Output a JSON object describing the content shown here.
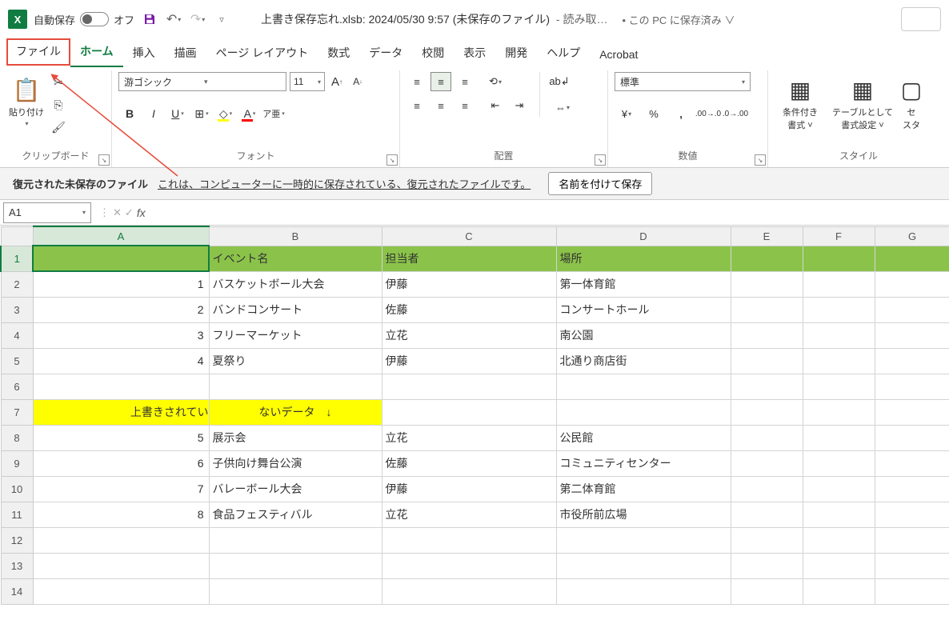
{
  "title": {
    "autosave_label": "自動保存",
    "autosave_state": "オフ",
    "filename": "上書き保存忘れ.xlsb: 2024/05/30 9:57 (未保存のファイル)",
    "readonly": " - 読み取…",
    "saved_location": "• この PC に保存済み ∨"
  },
  "menu": {
    "file": "ファイル",
    "home": "ホーム",
    "insert": "挿入",
    "draw": "描画",
    "layout": "ページ レイアウト",
    "formulas": "数式",
    "data": "データ",
    "review": "校閲",
    "view": "表示",
    "developer": "開発",
    "help": "ヘルプ",
    "acrobat": "Acrobat"
  },
  "ribbon": {
    "clipboard": {
      "paste": "貼り付け",
      "label": "クリップボード"
    },
    "font": {
      "name": "游ゴシック",
      "size": "11",
      "label": "フォント"
    },
    "align": {
      "label": "配置"
    },
    "number": {
      "format": "標準",
      "label": "数値"
    },
    "styles": {
      "cond": "条件付き\n書式 ˅",
      "table": "テーブルとして\n書式設定 ˅",
      "cell": "セ\nスタ",
      "label": "スタイル"
    }
  },
  "recovery": {
    "title": "復元された未保存のファイル",
    "msg": "これは、コンピューターに一時的に保存されている、復元されたファイルです。",
    "btn": "名前を付けて保存"
  },
  "namebox": "A1",
  "cols": [
    "A",
    "B",
    "C",
    "D",
    "E",
    "F",
    "G"
  ],
  "rows": [
    {
      "n": "1",
      "cls": "hdr-row",
      "A": "",
      "B": "イベント名",
      "C": "担当者",
      "D": "場所"
    },
    {
      "n": "2",
      "A": "1",
      "B": "バスケットボール大会",
      "C": "伊藤",
      "D": "第一体育館"
    },
    {
      "n": "3",
      "A": "2",
      "B": "バンドコンサート",
      "C": "佐藤",
      "D": "コンサートホール"
    },
    {
      "n": "4",
      "A": "3",
      "B": "フリーマーケット",
      "C": "立花",
      "D": "南公園"
    },
    {
      "n": "5",
      "A": "4",
      "B": "夏祭り",
      "C": "伊藤",
      "D": "北通り商店街"
    },
    {
      "n": "6",
      "A": "",
      "B": "",
      "C": "",
      "D": ""
    },
    {
      "n": "7",
      "cls": "yellow",
      "A": "上書きされてい",
      "B": "ないデータ　↓",
      "C": "",
      "D": ""
    },
    {
      "n": "8",
      "A": "5",
      "B": "展示会",
      "C": "立花",
      "D": "公民館"
    },
    {
      "n": "9",
      "A": "6",
      "B": "子供向け舞台公演",
      "C": "佐藤",
      "D": "コミュニティセンター"
    },
    {
      "n": "10",
      "A": "7",
      "B": "バレーボール大会",
      "C": "伊藤",
      "D": "第二体育館"
    },
    {
      "n": "11",
      "A": "8",
      "B": "食品フェスティバル",
      "C": "立花",
      "D": "市役所前広場"
    },
    {
      "n": "12",
      "A": "",
      "B": "",
      "C": "",
      "D": ""
    },
    {
      "n": "13",
      "A": "",
      "B": "",
      "C": "",
      "D": ""
    },
    {
      "n": "14",
      "A": "",
      "B": "",
      "C": "",
      "D": ""
    }
  ]
}
